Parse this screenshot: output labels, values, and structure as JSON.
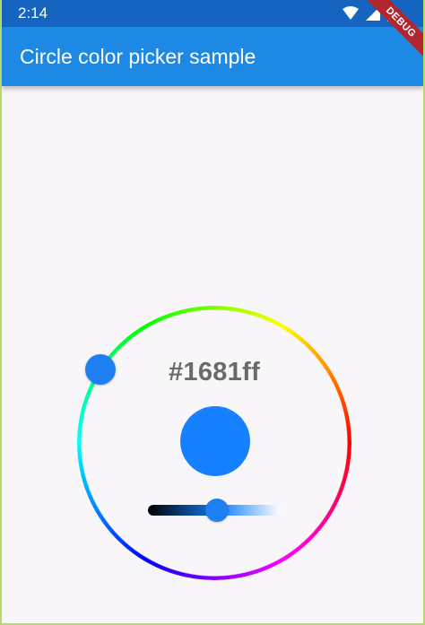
{
  "status_bar": {
    "time": "2:14",
    "icons": [
      "wifi-icon",
      "signal-icon",
      "battery-icon"
    ]
  },
  "debug_banner": {
    "label": "DEBUG",
    "color": "#b0272f"
  },
  "app_bar": {
    "title": "Circle color picker sample",
    "color": "#1e88e5"
  },
  "color_picker": {
    "hex_value": "#1681ff",
    "selected_color": "#1681ff",
    "hue_ring_colors": [
      "#ff0000",
      "#ff00ff",
      "#0000ff",
      "#00ffff",
      "#00ff00",
      "#ffff00"
    ],
    "lightness_fraction": 0.55
  }
}
